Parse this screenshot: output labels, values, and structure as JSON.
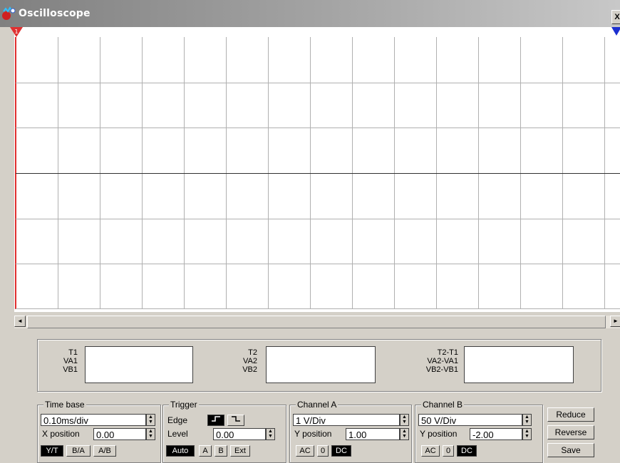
{
  "window": {
    "title": "Oscilloscope",
    "close_glyph": "X"
  },
  "icons": {
    "app": "oscilloscope-app-icon",
    "close": "close-icon"
  },
  "markers": {
    "left_label": "1",
    "left_color": "#e03030",
    "right_color": "#1c2fd0"
  },
  "screen": {
    "background": "#ffffff",
    "grid_color": "#b0b0b0",
    "center_line_color": "#303030",
    "cursor_color": "#e03030"
  },
  "scrollbar": {
    "left_glyph": "◄",
    "right_glyph": "►"
  },
  "readout": {
    "t1_labels": [
      "T1",
      "VA1",
      "VB1"
    ],
    "t2_labels": [
      "T2",
      "VA2",
      "VB2"
    ],
    "diff_labels": [
      "T2-T1",
      "VA2-VA1",
      "VB2-VB1"
    ]
  },
  "time_base": {
    "title": "Time base",
    "value": "0.10ms/div",
    "x_position_label": "X position",
    "x_position_value": "0.00",
    "modes": [
      "Y/T",
      "B/A",
      "A/B"
    ],
    "active_mode": "Y/T"
  },
  "trigger": {
    "title": "Trigger",
    "edge_label": "Edge",
    "level_label": "Level",
    "level_value": "0.00",
    "sources": [
      "Auto",
      "A",
      "B",
      "Ext"
    ],
    "active_source": "Auto"
  },
  "channel_a": {
    "title": "Channel A",
    "scale": "1  V/Div",
    "y_position_label": "Y position",
    "y_position_value": "1.00",
    "coupling": [
      "AC",
      "0",
      "DC"
    ],
    "active_coupling": "DC"
  },
  "channel_b": {
    "title": "Channel B",
    "scale": "50  V/Div",
    "y_position_label": "Y position",
    "y_position_value": "-2.00",
    "coupling": [
      "AC",
      "0",
      "DC"
    ],
    "active_coupling": "DC"
  },
  "actions": {
    "reduce": "Reduce",
    "reverse": "Reverse",
    "save": "Save"
  }
}
